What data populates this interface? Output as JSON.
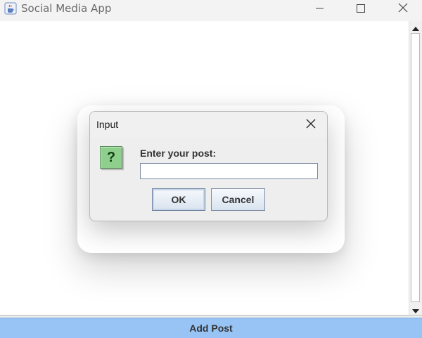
{
  "window": {
    "title": "Social Media App",
    "minimize_icon": "minimize-icon",
    "maximize_icon": "maximize-icon",
    "close_icon": "close-icon",
    "app_icon": "java-cup-icon"
  },
  "content": {
    "scrollbar": {
      "up_icon": "arrow-up-icon",
      "down_icon": "arrow-down-icon"
    }
  },
  "footer": {
    "add_post_label": "Add Post",
    "color": "#97c4f5"
  },
  "dialog": {
    "title": "Input",
    "close_icon": "close-icon",
    "question_icon_glyph": "?",
    "prompt": "Enter your post:",
    "input_value": "",
    "ok_label": "OK",
    "cancel_label": "Cancel"
  }
}
